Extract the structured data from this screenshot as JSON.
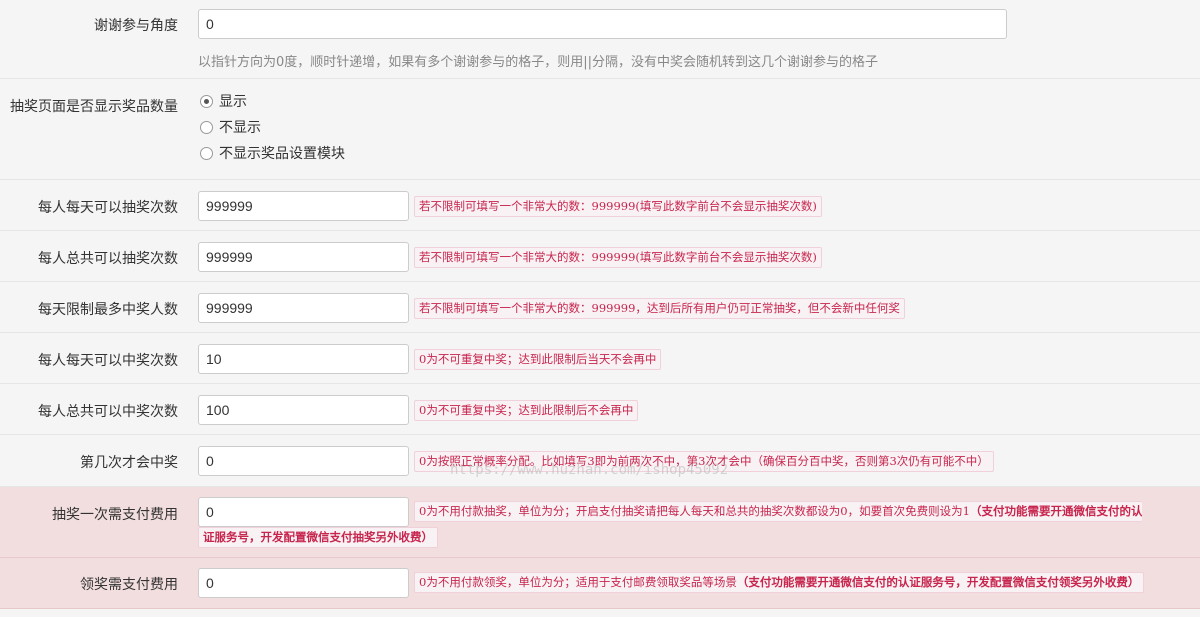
{
  "rows": [
    {
      "label": "谢谢参与角度",
      "value": "0",
      "help": "以指针方向为0度，顺时针递增，如果有多个谢谢参与的格子，则用||分隔，没有中奖会随机转到这几个谢谢参与的格子"
    },
    {
      "label": "抽奖页面是否显示奖品数量",
      "options": [
        "显示",
        "不显示",
        "不显示奖品设置模块"
      ],
      "selected": "显示"
    },
    {
      "label": "每人每天可以抽奖次数",
      "value": "999999",
      "note": "若不限制可填写一个非常大的数：999999(填写此数字前台不会显示抽奖次数)"
    },
    {
      "label": "每人总共可以抽奖次数",
      "value": "999999",
      "note": "若不限制可填写一个非常大的数：999999(填写此数字前台不会显示抽奖次数)"
    },
    {
      "label": "每天限制最多中奖人数",
      "value": "999999",
      "note": "若不限制可填写一个非常大的数：999999，达到后所有用户仍可正常抽奖，但不会新中任何奖"
    },
    {
      "label": "每人每天可以中奖次数",
      "value": "10",
      "note": "0为不可重复中奖；达到此限制后当天不会再中"
    },
    {
      "label": "每人总共可以中奖次数",
      "value": "100",
      "note": "0为不可重复中奖；达到此限制后不会再中"
    },
    {
      "label": "第几次才会中奖",
      "value": "0",
      "note": "0为按照正常概率分配。比如填写3即为前两次不中，第3次才会中（确保百分百中奖，否则第3次仍有可能不中）"
    },
    {
      "label": "抽奖一次需支付费用",
      "value": "0",
      "note_plain": "0为不用付款抽奖，单位为分；开启支付抽奖请把每人每天和总共的抽奖次数都设为0，如要首次免费则设为1",
      "note_bold_1": "（支付功能需要开通微信支付的认",
      "note_bold_2": "证服务号，开发配置微信支付抽奖另外收费）"
    },
    {
      "label": "领奖需支付费用",
      "value": "0",
      "note_plain": "0为不用付款领奖，单位为分；适用于支付邮费领取奖品等场景",
      "note_bold": "（支付功能需要开通微信支付的认证服务号，开发配置微信支付领奖另外收费）"
    }
  ],
  "watermark": "https://www.huzhan.com/ishop45092"
}
